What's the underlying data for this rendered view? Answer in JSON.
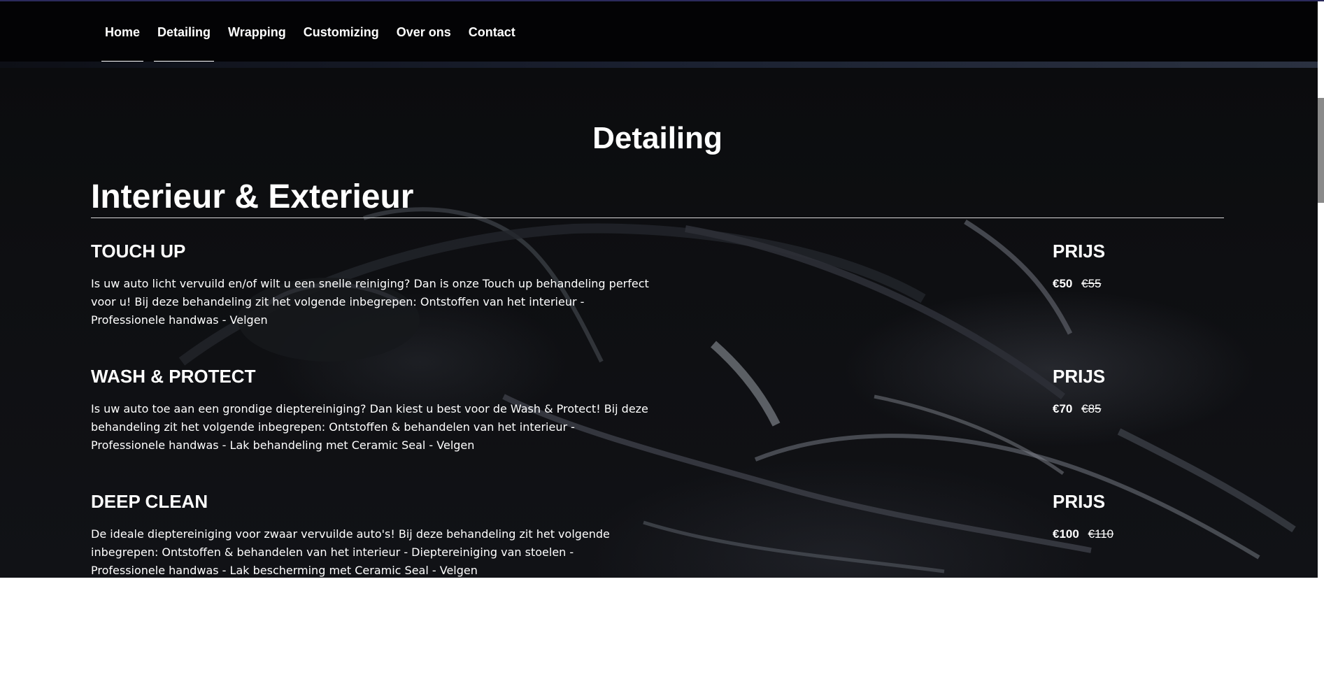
{
  "nav": {
    "items": [
      {
        "label": "Home"
      },
      {
        "label": "Detailing"
      },
      {
        "label": "Wrapping"
      },
      {
        "label": "Customizing"
      },
      {
        "label": "Over ons"
      },
      {
        "label": "Contact"
      }
    ],
    "active": [
      "Home",
      "Detailing"
    ]
  },
  "page": {
    "title": "Detailing",
    "section_title": "Interieur & Exterieur"
  },
  "services": [
    {
      "name": "TOUCH UP",
      "description": "Is uw auto licht vervuild en/of wilt u een snelle reiniging? Dan is onze Touch up behandeling perfect voor u! Bij deze behandeling zit het volgende inbegrepen: Ontstoffen van het interieur - Professionele handwas - Velgen",
      "price_label": "PRIJS",
      "price_new": "€50",
      "price_old": "€55"
    },
    {
      "name": "WASH & PROTECT",
      "description": "Is uw auto toe aan een grondige dieptereiniging? Dan kiest u best voor de Wash & Protect! Bij deze behandeling zit het volgende inbegrepen: Ontstoffen & behandelen van het interieur - Professionele handwas - Lak behandeling met Ceramic Seal - Velgen",
      "price_label": "PRIJS",
      "price_new": "€70",
      "price_old": "€85"
    },
    {
      "name": "DEEP CLEAN",
      "description": "De ideale dieptereiniging voor zwaar vervuilde auto's! Bij deze behandeling zit het volgende inbegrepen: Ontstoffen & behandelen van het interieur - Dieptereiniging van stoelen - Professionele handwas - Lak bescherming met Ceramic Seal - Velgen",
      "price_label": "PRIJS",
      "price_new": "€100",
      "price_old": "€110"
    }
  ],
  "colors": {
    "navbar_bg": "#030305",
    "hero_bg": "#0e0f12",
    "text": "#ffffff",
    "divider": "#d8d8d8",
    "scroll_thumb": "#8a8a8a"
  }
}
